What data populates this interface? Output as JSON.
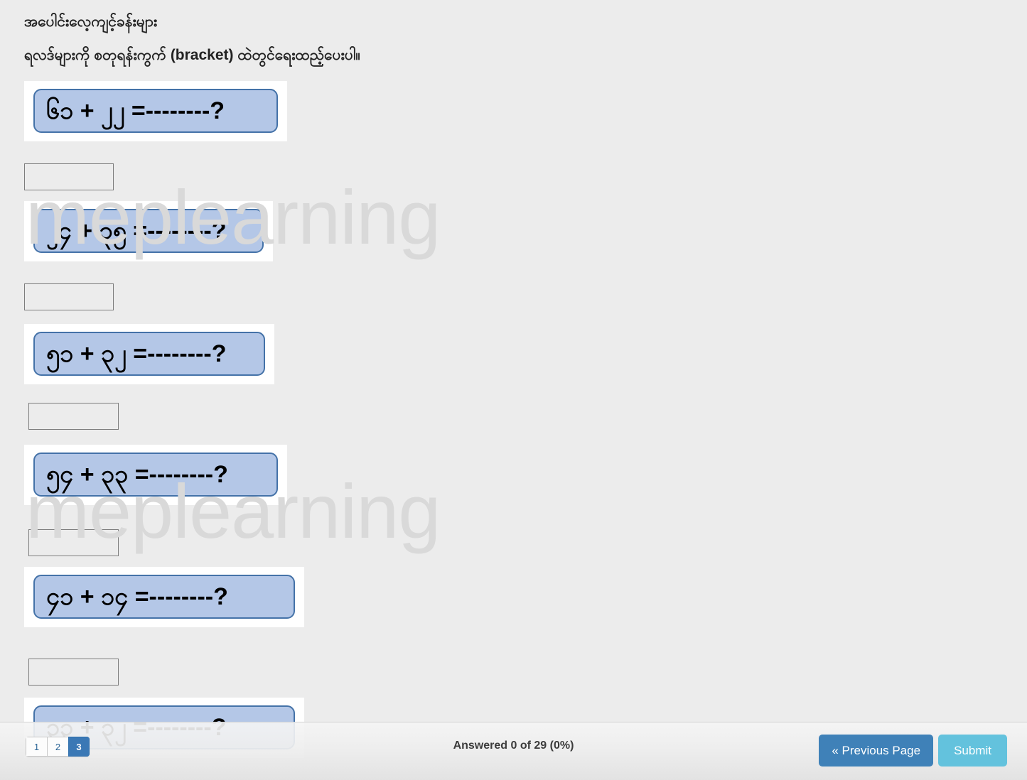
{
  "page": {
    "background_color": "#ececec",
    "watermark_text": "meplearning",
    "watermark_color": "#d9d9d9"
  },
  "header": {
    "title": "အပေါင်းလေ့ကျင့်ခန်းများ",
    "instruction": "ရလဒ်များကို စတုရန်းကွက် (bracket) ထဲတွင်ရေးထည့်ပေးပါ။"
  },
  "questions": [
    {
      "text": "၆၁ + ၂၂ =--------?",
      "answer_value": "",
      "answer_placeholder": ""
    },
    {
      "text": "၂၄ + ၃၅ =--------?",
      "answer_value": "",
      "answer_placeholder": ""
    },
    {
      "text": "၅၁ + ၃၂ =--------?",
      "answer_value": "",
      "answer_placeholder": ""
    },
    {
      "text": "၅၄ + ၃၃ =--------?",
      "answer_value": "",
      "answer_placeholder": ""
    },
    {
      "text": "၄၁ + ၁၄ =--------?",
      "answer_value": "",
      "answer_placeholder": ""
    },
    {
      "text": "၃၃ + ၃၂ =--------?",
      "answer_value": "",
      "answer_placeholder": ""
    }
  ],
  "footer": {
    "pagination": [
      {
        "label": "1",
        "active": false
      },
      {
        "label": "2",
        "active": false
      },
      {
        "label": "3",
        "active": true
      }
    ],
    "status": "Answered 0 of 29 (0%)",
    "previous_label": "« Previous Page",
    "submit_label": "Submit",
    "previous_color": "#3f81b8",
    "submit_color": "#63c2dd"
  },
  "style": {
    "pill_fill": "#b4c7e7",
    "pill_border": "#4472a8",
    "card_bg": "#ffffff",
    "input_border": "#7d7d7d"
  }
}
